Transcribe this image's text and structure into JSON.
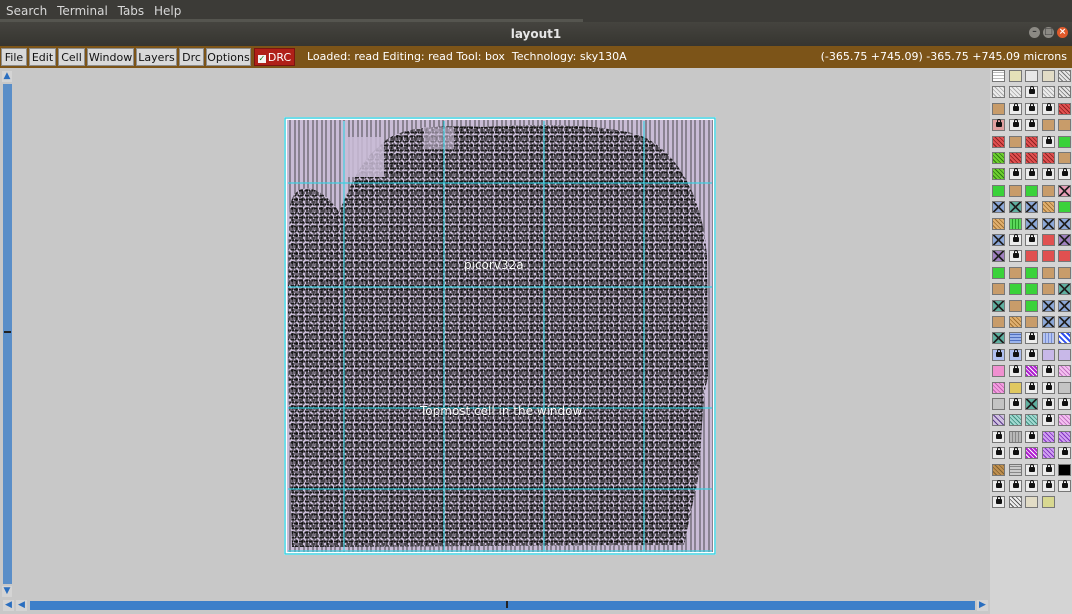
{
  "menubar": {
    "items": [
      "Search",
      "Terminal",
      "Tabs",
      "Help"
    ]
  },
  "window": {
    "title": "layout1",
    "controls": [
      "minimize-icon",
      "maximize-icon",
      "close-icon"
    ]
  },
  "toolbar": {
    "buttons": [
      "File",
      "Edit",
      "Cell",
      "Window",
      "Layers",
      "Drc",
      "Options"
    ],
    "drc_toggle": {
      "label": "DRC",
      "checked": true
    },
    "status": "Loaded: read Editing: read Tool: box  Technology: sky130A",
    "coords": "(-365.75 +745.09) -365.75 +745.09 microns"
  },
  "canvas": {
    "cell_label": "picorv32a",
    "top_label": "Topmost cell in the window"
  },
  "colors": {
    "menubar_bg": "#3c3b37",
    "toolbar_bg": "#7c5418",
    "drc_bg": "#b02018",
    "canvas_bg": "#c8c8c8",
    "layout_fill": "#c9bcd6",
    "layout_ink": "#1e1e1e",
    "grid_cyan": "#3fd0e0",
    "scroll_blue": "#3d7fc9"
  },
  "palette": {
    "rows": [
      [
        "dots",
        "sand",
        "gray-box",
        "beige",
        "hatch"
      ],
      [
        "hatch-light",
        "hatch-light",
        "lock",
        "hatch-light",
        "hatch"
      ],
      [
        "tan",
        "lock",
        "lock",
        "lock",
        "red-hatch"
      ],
      [
        "lock-red",
        "lock",
        "lock",
        "tan",
        "tan"
      ],
      [
        "red-hatch",
        "tan",
        "red-hatch",
        "lock",
        "green"
      ],
      [
        "green-hatch",
        "red-hatch",
        "red-hatch",
        "red-hatch",
        "tan"
      ],
      [
        "green-hatch",
        "lock",
        "lock",
        "lock",
        "lock"
      ],
      [
        "green",
        "tan",
        "green",
        "tan",
        "x-pink"
      ],
      [
        "x-blue",
        "x-teal",
        "x-blue",
        "tan-hatch",
        "green"
      ],
      [
        "tan-hatch",
        "green-dots",
        "x-blue",
        "x-blue",
        "x-blue"
      ],
      [
        "x-blue",
        "lock",
        "lock",
        "red",
        "x-purple"
      ],
      [
        "x-purple",
        "lock",
        "red",
        "red",
        "red"
      ],
      [
        "green",
        "tan",
        "green",
        "tan",
        "tan"
      ],
      [
        "tan",
        "green",
        "green",
        "tan",
        "x-teal"
      ],
      [
        "x-teal",
        "tan",
        "green",
        "x-blue",
        "x-blue"
      ],
      [
        "tan",
        "tan-hatch",
        "tan",
        "x-blue",
        "x-blue"
      ],
      [
        "x-teal",
        "blue-hatch",
        "lock",
        "blue-dots",
        "blue-check"
      ],
      [
        "lock-blue",
        "lock-blue",
        "lock",
        "lavender",
        "lavender"
      ],
      [
        "pink",
        "lock",
        "purple-check",
        "lock",
        "pink-dots"
      ],
      [
        "pink-hatch",
        "yellow-x",
        "lock",
        "lock",
        "gray"
      ],
      [
        "gray",
        "lock",
        "x-teal",
        "lock",
        "lock"
      ],
      [
        "purple-diag",
        "teal-hatch",
        "teal-hatch",
        "lock",
        "pink-dots"
      ],
      [
        "lock",
        "gray-dots",
        "lock",
        "purple-hatch",
        "purple-hatch"
      ],
      [
        "lock",
        "lock",
        "purple-check",
        "purple-hatch",
        "lock"
      ],
      [
        "tan-check",
        "gray-lines",
        "lock",
        "lock",
        "black"
      ],
      [
        "lock",
        "lock",
        "lock",
        "lock",
        "lock"
      ],
      [
        "lock",
        "diag",
        "beige",
        "olive"
      ]
    ]
  }
}
